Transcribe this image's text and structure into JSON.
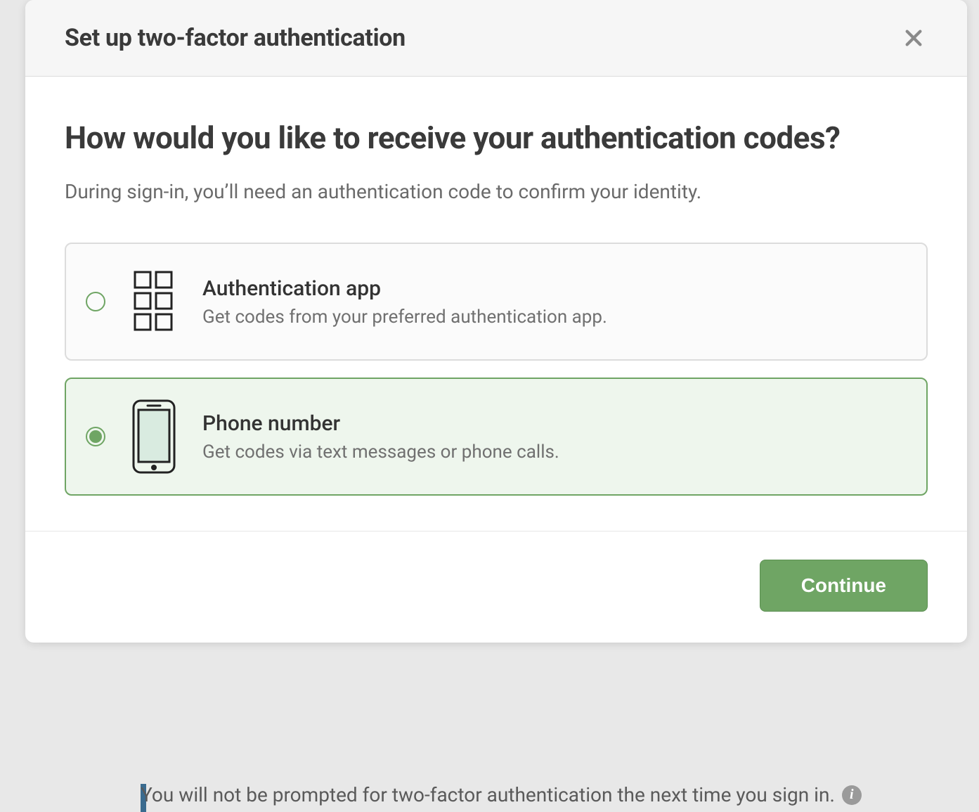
{
  "modal": {
    "title": "Set up two-factor authentication",
    "heading": "How would you like to receive your authentication codes?",
    "subtext": "During sign-in, you’ll need an authentication code to confirm your identity.",
    "options": {
      "app": {
        "title": "Authentication app",
        "desc": "Get codes from your preferred authentication app.",
        "selected": false
      },
      "phone": {
        "title": "Phone number",
        "desc": "Get codes via text messages or phone calls.",
        "selected": true
      }
    },
    "continue_label": "Continue"
  },
  "background": {
    "notice": "You will not be prompted for two-factor authentication the next time you sign in."
  },
  "colors": {
    "accent": "#6fa564"
  }
}
